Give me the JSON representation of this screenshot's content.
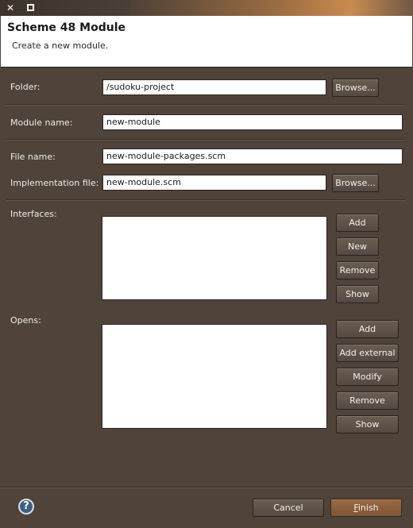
{
  "titlebar": {
    "close_glyph": "✕",
    "maximize_glyph": ""
  },
  "header": {
    "title": "Scheme 48 Module",
    "description": "Create a new module."
  },
  "form": {
    "folder_label": "Folder:",
    "folder_value": "/sudoku-project",
    "module_name_label": "Module name:",
    "module_name_value": "new-module",
    "file_name_label": "File name:",
    "file_name_value": "new-module-packages.scm",
    "impl_file_label": "Implementation file:",
    "impl_file_value": "new-module.scm",
    "browse_label": "Browse..."
  },
  "interfaces": {
    "label": "Interfaces:",
    "buttons": [
      "Add",
      "New",
      "Remove",
      "Show"
    ]
  },
  "opens": {
    "label": "Opens:",
    "buttons": [
      "Add",
      "Add external",
      "Modify",
      "Remove",
      "Show"
    ]
  },
  "footer": {
    "help_glyph": "?",
    "cancel_label": "Cancel",
    "finish_first": "F",
    "finish_rest": "inish"
  }
}
